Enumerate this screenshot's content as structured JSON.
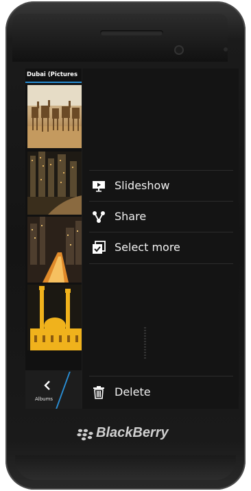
{
  "gallery": {
    "title": "Dubai (Pictures",
    "back_label": "Albums",
    "back_icon": "chevron-left-icon"
  },
  "context_menu": {
    "items": [
      {
        "label": "Slideshow",
        "icon": "slideshow-icon"
      },
      {
        "label": "Share",
        "icon": "share-icon"
      },
      {
        "label": "Select more",
        "icon": "select-more-icon"
      }
    ],
    "delete_label": "Delete",
    "delete_icon": "trash-icon"
  },
  "device": {
    "brand": "BlackBerry"
  },
  "colors": {
    "accent": "#2a8fd6",
    "menu_bg": "#141414"
  }
}
